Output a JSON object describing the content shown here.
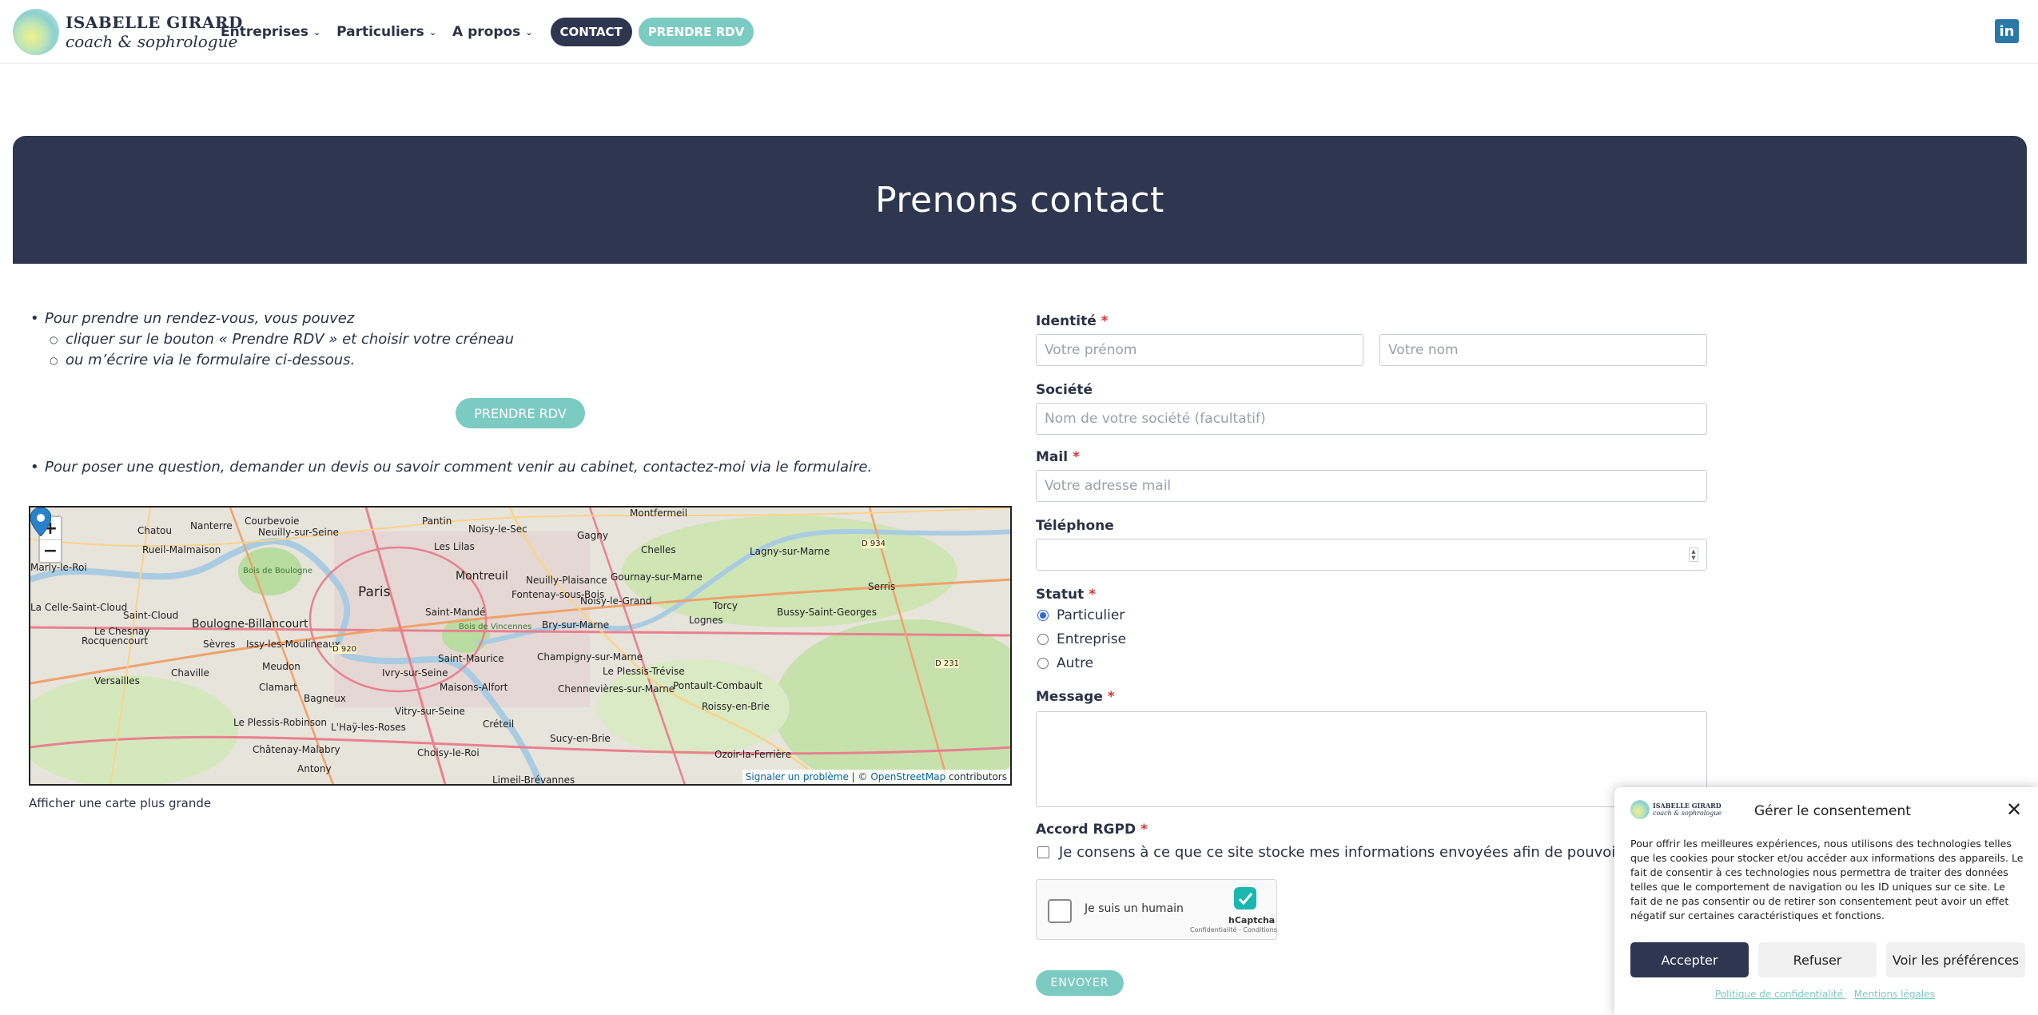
{
  "brand": {
    "name": "ISABELLE GIRARD",
    "tagline": "coach & sophrologue"
  },
  "nav": {
    "items": [
      {
        "label": "Entreprises"
      },
      {
        "label": "Particuliers"
      },
      {
        "label": "A propos"
      }
    ],
    "contact_label": "CONTACT",
    "rdv_label": "PRENDRE RDV",
    "linkedin_label": "in"
  },
  "banner": {
    "title": "Prenons contact"
  },
  "intro": {
    "bullet1": "Pour prendre un rendez-vous, vous pouvez",
    "sub1": "cliquer sur le bouton « Prendre RDV » et choisir votre créneau",
    "sub2": "ou m’écrire via le formulaire ci-dessous.",
    "rdv_button": "PRENDRE RDV",
    "bullet2": "Pour poser une question, demander un devis ou savoir comment venir au cabinet, contactez-moi via le formulaire."
  },
  "map": {
    "zoom_in": "+",
    "zoom_out": "−",
    "labels": [
      "Montfermeil",
      "Courbevoie",
      "Nanterre",
      "Chatou",
      "Neuilly-sur-Seine",
      "Pantin",
      "Noisy-le-Sec",
      "Gagny",
      "Rueil-Malmaison",
      "Les Lilas",
      "Chelles",
      "Lagny-sur-Marne",
      "Marly-le-Roi",
      "Paris",
      "Montreuil",
      "Neuilly-Plaisance",
      "Gournay-sur-Marne",
      "Saint-Mandé",
      "Fontenay-sous-Bois",
      "Noisy-le-Grand",
      "Torcy",
      "Bussy-Saint-Georges",
      "Boulogne-Billancourt",
      "Issy-les-Moulineaux",
      "Bry-sur-Marne",
      "Lognes",
      "Le Chesnay",
      "Rocquencourt",
      "Sèvres",
      "Saint-Maurice",
      "Champigny-sur-Marne",
      "Versailles",
      "Chaville",
      "Meudon",
      "Ivry-sur-Seine",
      "Le Plessis-Trévise",
      "Pontault-Combault",
      "Clamart",
      "Maisons-Alfort",
      "Chennevières-sur-Marne",
      "Bagneux",
      "Vitry-sur-Seine",
      "Créteil",
      "Roissy-en-Brie",
      "Le Plessis-Robinson",
      "L'Haÿ-les-Roses",
      "Sucy-en-Brie",
      "Châtenay-Malabry",
      "Choisy-le-Roi",
      "Ozoir-la-Ferrière",
      "Antony",
      "Limeil-Brévannes",
      "La Celle-Saint-Cloud",
      "Serris",
      "Saint-Cloud",
      "Bois de Boulogne",
      "Bois de Vincennes",
      "D 934",
      "D 231",
      "D 920"
    ],
    "attribution_link1": "Signaler un problème",
    "attribution_sep": " | © ",
    "attribution_link2": "OpenStreetMap",
    "attribution_tail": " contributors",
    "caption": "Afficher une carte plus grande"
  },
  "form": {
    "identity_label": "Identité",
    "firstname_placeholder": "Votre prénom",
    "lastname_placeholder": "Votre nom",
    "company_label": "Société",
    "company_placeholder": "Nom de votre société (facultatif)",
    "mail_label": "Mail",
    "mail_placeholder": "Votre adresse mail",
    "phone_label": "Téléphone",
    "status_label": "Statut",
    "status_options": [
      "Particulier",
      "Entreprise",
      "Autre"
    ],
    "status_selected": "Particulier",
    "message_label": "Message",
    "gdpr_label": "Accord RGPD",
    "gdpr_text": "Je consens à ce que ce site stocke mes informations envoyées afin de pouvoir répondre",
    "required_mark": "*",
    "captcha_text": "Je suis un humain",
    "captcha_brand": "hCaptcha",
    "captcha_small": "Confidentialité - Conditions",
    "submit_label": "ENVOYER"
  },
  "consent": {
    "title": "Gérer le consentement",
    "logo_name": "ISABELLE GIRARD",
    "logo_sub": "coach & sophrologue",
    "body": "Pour offrir les meilleures expériences, nous utilisons des technologies telles que les cookies pour stocker et/ou accéder aux informations des appareils. Le fait de consentir à ces technologies nous permettra de traiter des données telles que le comportement de navigation ou les ID uniques sur ce site. Le fait de ne pas consentir ou de retirer son consentement peut avoir un effet négatif sur certaines caractéristiques et fonctions.",
    "accept": "Accepter",
    "refuse": "Refuser",
    "preferences": "Voir les préférences",
    "link_privacy": "Politique de confidentialité",
    "link_legal": "Mentions légales",
    "close": "✕"
  },
  "colors": {
    "navy": "#2f3650",
    "teal": "#7ccbc2",
    "required": "#d63638",
    "radio_selected": "#2f6bd6"
  }
}
